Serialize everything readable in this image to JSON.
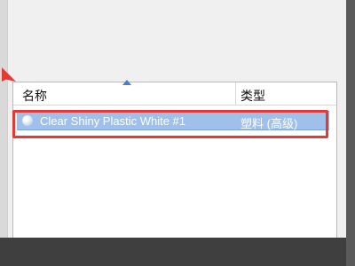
{
  "list": {
    "columns": [
      {
        "label": "名称"
      },
      {
        "label": "类型"
      }
    ],
    "rows": [
      {
        "name": "Clear Shiny Plastic White #1",
        "type": "塑料 (高级)",
        "selected": true
      }
    ]
  },
  "colors": {
    "selection": "#9ec0ea",
    "highlight_box": "#e53935",
    "sort_arrow": "#4a7ec8"
  },
  "icons": {
    "row_icon": "material-sphere-icon",
    "sort_indicator": "sort-ascending-icon",
    "pointer_arrow": "red-arrow-pointer-icon",
    "splitter_handle": "more-dots-icon"
  }
}
